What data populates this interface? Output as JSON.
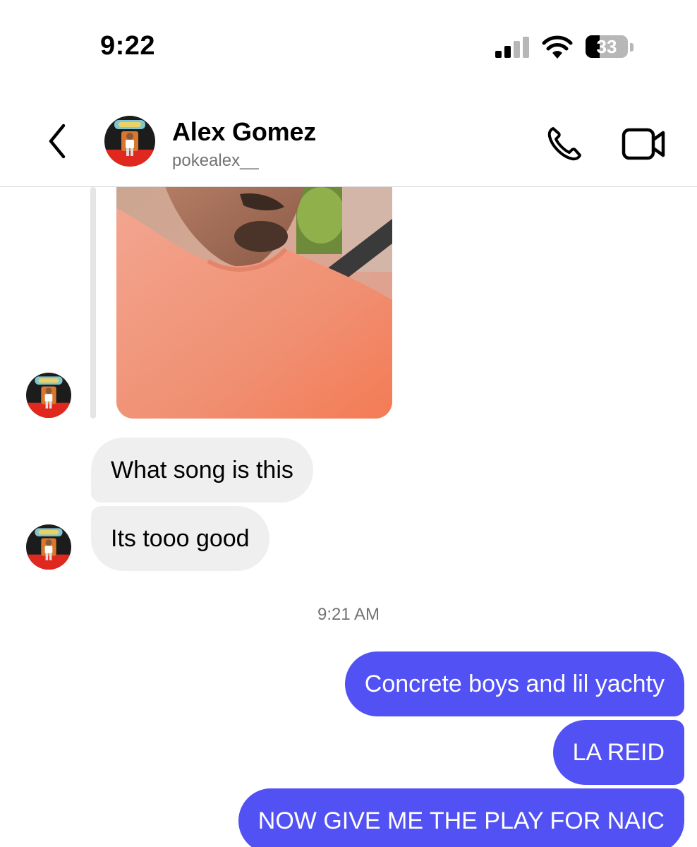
{
  "status_bar": {
    "time": "9:22",
    "battery_level": "33",
    "battery_fraction": 0.33
  },
  "header": {
    "name": "Alex Gomez",
    "username": "pokealex__"
  },
  "icons": {
    "back": "chevron-left-icon",
    "call": "phone-icon",
    "video": "video-camera-icon"
  },
  "colors": {
    "outgoing_bubble": "#5151f4",
    "incoming_bubble": "#efefef",
    "secondary_text": "#737373"
  },
  "messages": [
    {
      "sender": "them",
      "type": "image"
    },
    {
      "sender": "them",
      "type": "text",
      "text": "What song is this"
    },
    {
      "sender": "them",
      "type": "text",
      "text": "Its tooo good"
    },
    {
      "sender": "me",
      "type": "text",
      "text": "Concrete boys and lil yachty"
    },
    {
      "sender": "me",
      "type": "text",
      "text": "LA REID"
    },
    {
      "sender": "me",
      "type": "text",
      "text": "NOW GIVE ME THE PLAY FOR NAIC"
    }
  ],
  "timestamp": "9:21 AM"
}
